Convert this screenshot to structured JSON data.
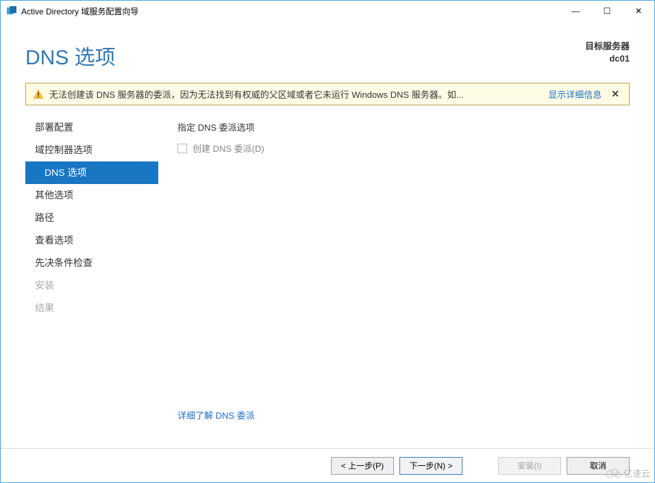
{
  "window": {
    "title": "Active Directory 域服务配置向导",
    "minimize": "—",
    "maximize": "☐",
    "close": "✕"
  },
  "header": {
    "page_title": "DNS 选项",
    "target_label": "目标服务器",
    "target_value": "dc01"
  },
  "warning": {
    "text": "无法创建该 DNS 服务器的委派，因为无法找到有权威的父区域或者它未运行 Windows DNS 服务器。如...",
    "link": "显示详细信息",
    "close": "✕"
  },
  "sidebar": {
    "items": [
      {
        "label": "部署配置",
        "indent": false,
        "selected": false,
        "disabled": false
      },
      {
        "label": "域控制器选项",
        "indent": false,
        "selected": false,
        "disabled": false
      },
      {
        "label": "DNS 选项",
        "indent": true,
        "selected": true,
        "disabled": false
      },
      {
        "label": "其他选项",
        "indent": false,
        "selected": false,
        "disabled": false
      },
      {
        "label": "路径",
        "indent": false,
        "selected": false,
        "disabled": false
      },
      {
        "label": "查看选项",
        "indent": false,
        "selected": false,
        "disabled": false
      },
      {
        "label": "先决条件检查",
        "indent": false,
        "selected": false,
        "disabled": false
      },
      {
        "label": "安装",
        "indent": false,
        "selected": false,
        "disabled": true
      },
      {
        "label": "结果",
        "indent": false,
        "selected": false,
        "disabled": true
      }
    ]
  },
  "content": {
    "section_label": "指定 DNS 委派选项",
    "checkbox_label": "创建 DNS 委派(D)",
    "details_link": "详细了解 DNS 委派"
  },
  "footer": {
    "prev": "< 上一步(P)",
    "next": "下一步(N) >",
    "install": "安装(I)",
    "cancel": "取消"
  },
  "watermark": "亿速云"
}
